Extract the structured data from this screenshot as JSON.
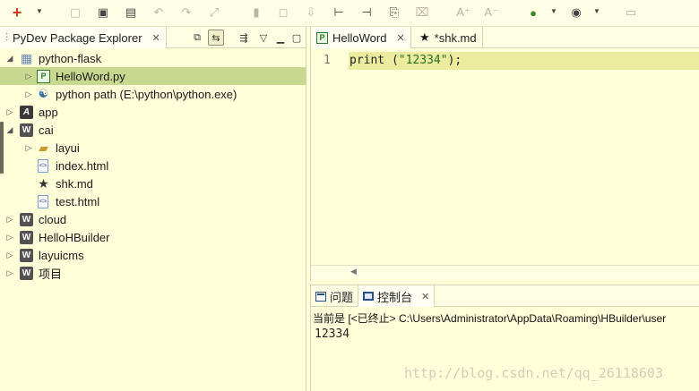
{
  "toolbar": {
    "icons": [
      "new-icon",
      "dropdown-icon",
      "save-icon",
      "save-all-icon",
      "print-icon",
      "undo-icon",
      "redo-icon",
      "format-icon",
      "bookmark-icon",
      "new-file-icon",
      "import-icon",
      "step-icon",
      "step-out-icon",
      "console-icon",
      "clear-icon",
      "font-increase-icon",
      "font-decrease-icon",
      "run-icon",
      "run-dropdown-icon",
      "debug-icon",
      "debug-dropdown-icon",
      "info-icon"
    ],
    "font_increase_glyph": "A⁺",
    "font_decrease_glyph": "A⁻"
  },
  "explorer": {
    "title": "PyDev Package Explorer",
    "tree": [
      {
        "label": "python-flask",
        "icon": "project-icon",
        "expanded": true
      },
      {
        "label": "HelloWord.py",
        "icon": "python-file-icon",
        "selected": true
      },
      {
        "label": "python path  (E:\\python\\python.exe)",
        "icon": "python-interpreter-icon"
      },
      {
        "label": "app",
        "icon": "app-project-icon"
      },
      {
        "label": "cai",
        "icon": "web-project-icon",
        "expanded": true
      },
      {
        "label": "layui",
        "icon": "folder-icon"
      },
      {
        "label": "index.html",
        "icon": "html-file-icon"
      },
      {
        "label": "shk.md",
        "icon": "markdown-file-icon"
      },
      {
        "label": "test.html",
        "icon": "html-file-icon"
      },
      {
        "label": "cloud",
        "icon": "web-project-icon"
      },
      {
        "label": "HelloHBuilder",
        "icon": "web-project-icon"
      },
      {
        "label": "layuicms",
        "icon": "web-project-icon"
      },
      {
        "label": "项目",
        "icon": "web-project-icon"
      }
    ]
  },
  "editor": {
    "tabs": [
      {
        "label": "HelloWord",
        "active": true
      },
      {
        "label": "*shk.md",
        "active": false
      }
    ],
    "line_number": "1",
    "code_prefix": "print (",
    "code_string": "\"12334\"",
    "code_suffix": ");"
  },
  "console": {
    "tabs": [
      {
        "label": "问题",
        "active": false
      },
      {
        "label": "控制台",
        "active": true
      }
    ],
    "status": "当前是 [<已终止> C:\\Users\\Administrator\\AppData\\Roaming\\HBuilder\\user",
    "output": "12334",
    "watermark": "http://blog.csdn.net/qq_26118603"
  }
}
